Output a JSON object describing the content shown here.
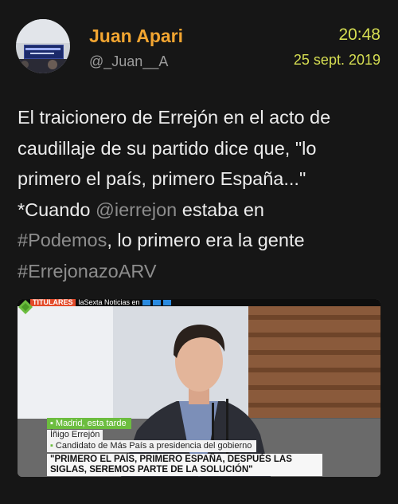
{
  "user": {
    "name": "Juan Apari",
    "handle": "@_Juan__A"
  },
  "meta": {
    "time": "20:48",
    "date": "25 sept. 2019"
  },
  "tweet": {
    "line1": "El traicionero de Errejón en el acto de",
    "line2": "caudillaje de su partido dice que, \"lo",
    "line3": "primero el país, primero España...\"",
    "line4_pre": "*Cuando ",
    "mention": "@ierrejon",
    "line4_post": " estaba en",
    "hashtag1": "#Podemos",
    "line5_post": ", lo primero era la gente",
    "hashtag2": "#ErrejonazoARV"
  },
  "media": {
    "ticker_tag": "TITULARES",
    "channel": "laSexta Noticias en",
    "location": "Madrid, esta tarde",
    "person_name": "Íñigo Errejón",
    "person_role": "Candidato de Más País a presidencia del gobierno",
    "quote_line1": "\"PRIMERO EL PAÍS, PRIMERO ESPAÑA, DESPUÉS LAS",
    "quote_line2": "SIGLAS, SEREMOS PARTE DE LA SOLUCIÓN\""
  },
  "colors": {
    "name": "#f2a531",
    "timestamp": "#d6de52",
    "accent_green": "#6cbd3f"
  }
}
